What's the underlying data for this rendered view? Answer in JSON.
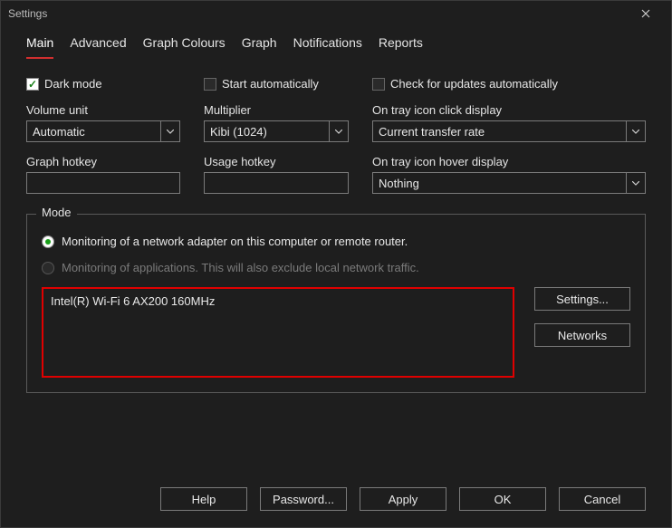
{
  "window": {
    "title": "Settings"
  },
  "tabs": {
    "main": "Main",
    "advanced": "Advanced",
    "graph_colours": "Graph Colours",
    "graph": "Graph",
    "notifications": "Notifications",
    "reports": "Reports"
  },
  "checks": {
    "dark_mode": {
      "label": "Dark mode",
      "checked": true
    },
    "start_auto": {
      "label": "Start automatically",
      "checked": false
    },
    "check_updates": {
      "label": "Check for updates automatically",
      "checked": false
    }
  },
  "fields": {
    "volume_unit": {
      "label": "Volume unit",
      "value": "Automatic"
    },
    "multiplier": {
      "label": "Multiplier",
      "value": "Kibi (1024)"
    },
    "tray_click": {
      "label": "On tray icon click display",
      "value": "Current transfer rate"
    },
    "graph_hotkey": {
      "label": "Graph hotkey",
      "value": ""
    },
    "usage_hotkey": {
      "label": "Usage hotkey",
      "value": ""
    },
    "tray_hover": {
      "label": "On tray icon hover display",
      "value": "Nothing"
    }
  },
  "mode": {
    "legend": "Mode",
    "radio_net": "Monitoring of a network adapter on this computer or remote router.",
    "radio_apps": "Monitoring of applications. This will also exclude local network traffic.",
    "adapter": "Intel(R) Wi-Fi 6 AX200 160MHz",
    "settings_btn": "Settings...",
    "networks_btn": "Networks"
  },
  "footer": {
    "help": "Help",
    "password": "Password...",
    "apply": "Apply",
    "ok": "OK",
    "cancel": "Cancel"
  }
}
